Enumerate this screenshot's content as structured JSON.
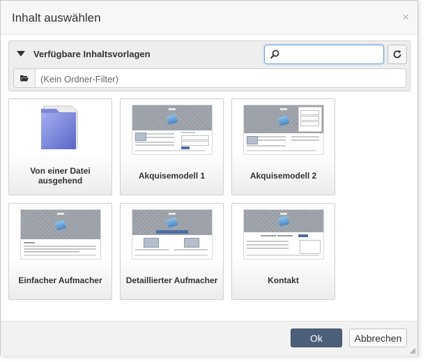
{
  "dialog": {
    "title": "Inhalt auswählen",
    "close_glyph": "×"
  },
  "panel": {
    "label": "Verfügbare Inhaltsvorlagen",
    "search": {
      "value": "",
      "placeholder": ""
    },
    "folder_filter": {
      "value": "",
      "placeholder": "(Kein Ordner-Filter)"
    }
  },
  "tiles": [
    {
      "label": "Von einer Datei ausgehend",
      "icon": "folder-icon"
    },
    {
      "label": "Akquisemodell 1",
      "icon": "template-thumbnail"
    },
    {
      "label": "Akquisemodell 2",
      "icon": "template-thumbnail"
    },
    {
      "label": "Einfacher Aufmacher",
      "icon": "template-thumbnail"
    },
    {
      "label": "Detaillierter Aufmacher",
      "icon": "template-thumbnail"
    },
    {
      "label": "Kontakt",
      "icon": "template-thumbnail"
    }
  ],
  "footer": {
    "ok_label": "Ok",
    "cancel_label": "Abbrechen"
  },
  "colors": {
    "primary_button": "#4c5f7a",
    "search_focus": "#6fa3d8",
    "panel_bg": "#eeeeee"
  }
}
